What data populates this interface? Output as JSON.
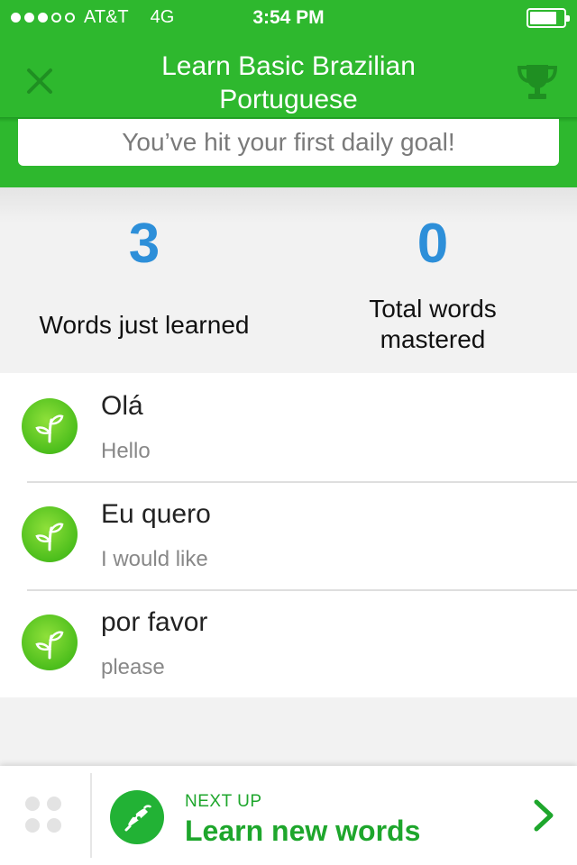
{
  "status_bar": {
    "carrier": "AT&T",
    "network": "4G",
    "time": "3:54 PM",
    "signal_bars_filled": 3,
    "signal_bars_total": 5,
    "battery_level": 0.8
  },
  "header": {
    "title": "Learn Basic Brazilian Portuguese",
    "close_icon": "close-icon",
    "trophy_icon": "trophy-icon"
  },
  "goal_message": "You’ve hit your first daily goal!",
  "stats": {
    "learned": {
      "value": "3",
      "label": "Words just learned"
    },
    "mastered": {
      "value": "0",
      "label": "Total words mastered"
    }
  },
  "words": [
    {
      "term": "Olá",
      "definition": "Hello",
      "icon": "sprout-icon"
    },
    {
      "term": "Eu quero",
      "definition": "I would like",
      "icon": "sprout-icon"
    },
    {
      "term": "por favor",
      "definition": "please",
      "icon": "sprout-icon"
    }
  ],
  "bottom_bar": {
    "next_up_label": "NEXT UP",
    "next_up_title": "Learn new words",
    "next_icon": "watering-can-icon",
    "menu_icon": "menu-dots-icon",
    "chevron_icon": "chevron-right-icon"
  },
  "colors": {
    "brand_green": "#2eb82e",
    "stat_blue": "#2d8fd9",
    "next_green": "#1ea62c"
  }
}
